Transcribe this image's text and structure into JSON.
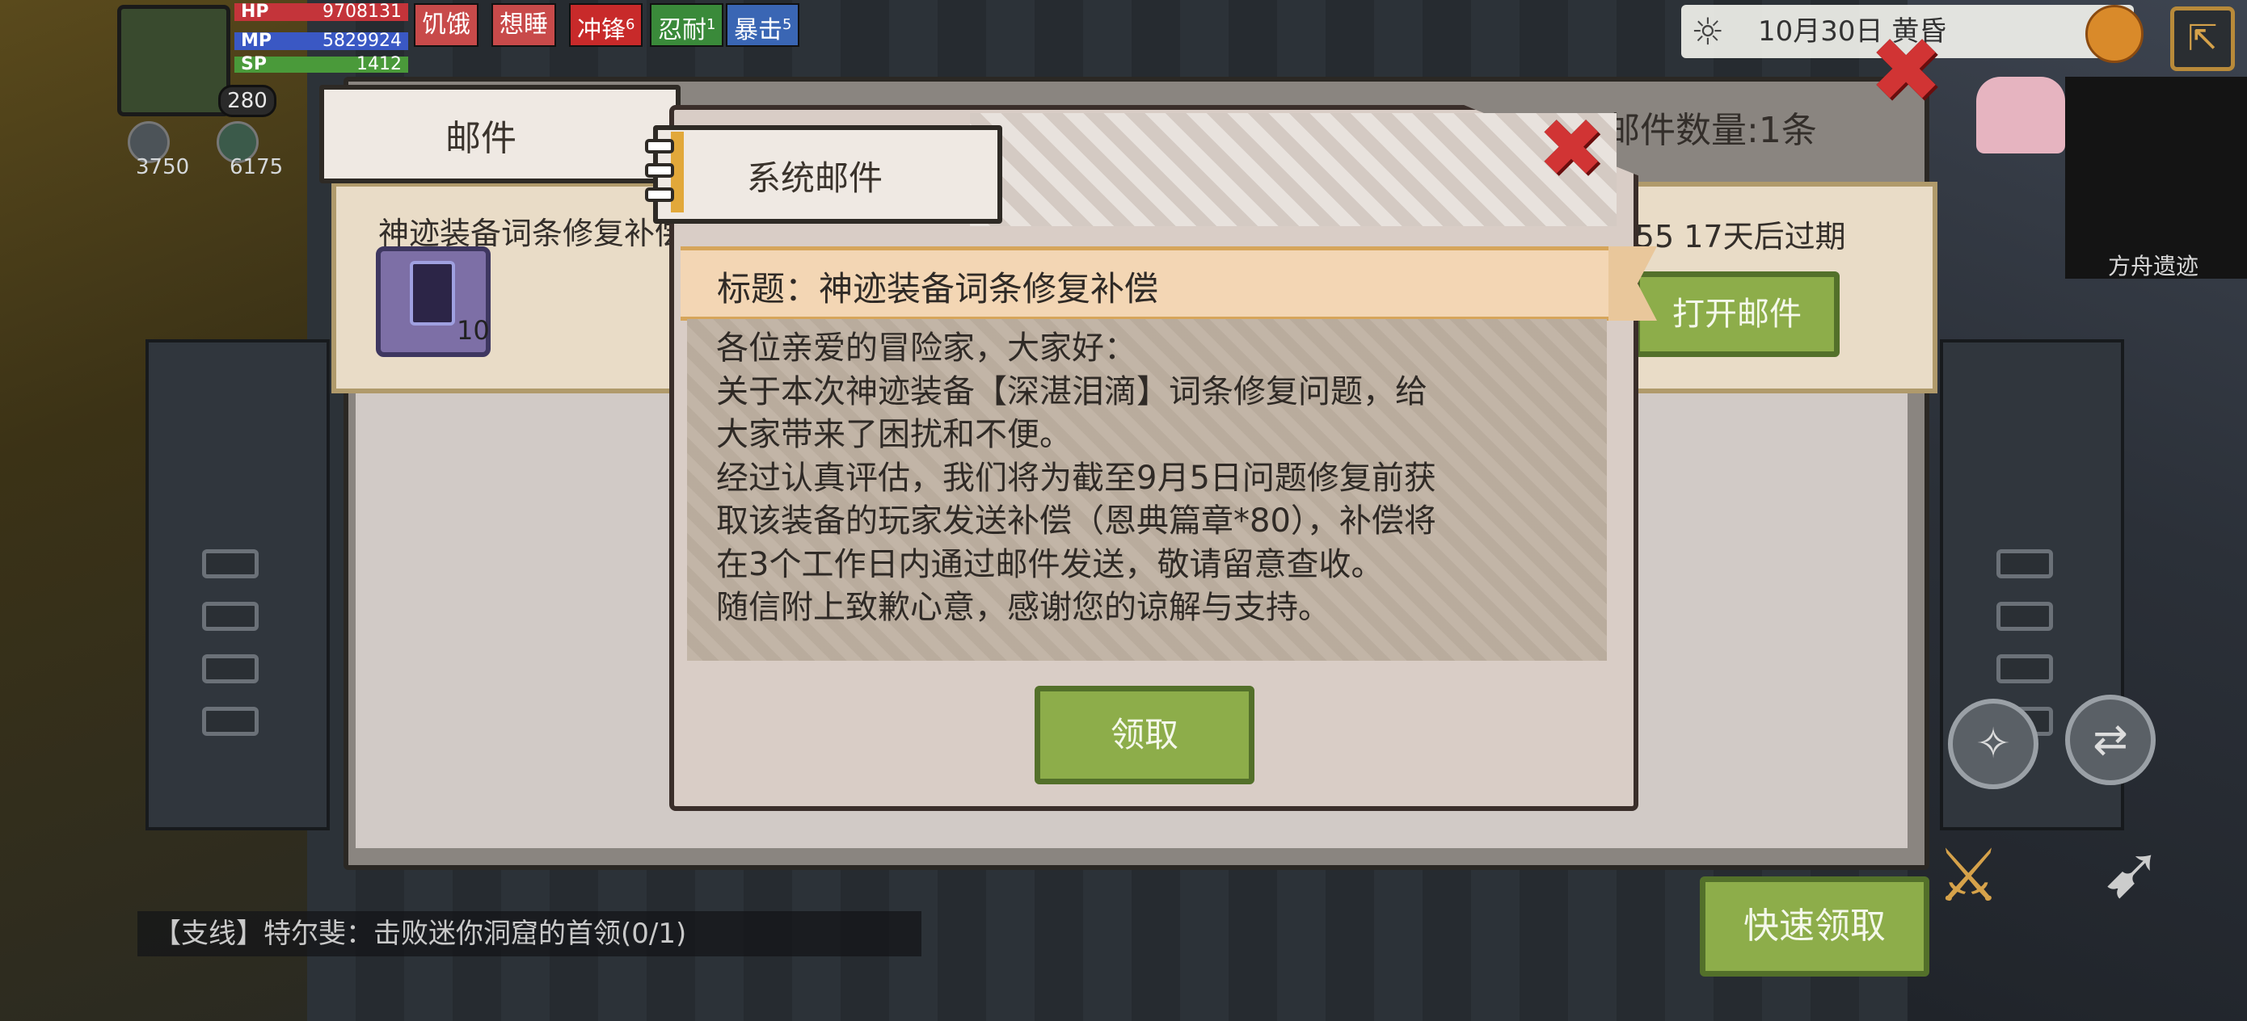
{
  "hud": {
    "level": "280",
    "hp": {
      "label": "HP",
      "value": "9708131",
      "color": "#c4343a"
    },
    "mp": {
      "label": "MP",
      "value": "5829924",
      "color": "#3a58c4"
    },
    "sp": {
      "label": "SP",
      "value": "1412",
      "color": "#4a9a3a"
    },
    "statuses": [
      {
        "label": "饥饿",
        "sup": "",
        "color": "#c84a4a"
      },
      {
        "label": "想睡",
        "sup": "",
        "color": "#c84a4a"
      },
      {
        "label": "冲锋",
        "sup": "6",
        "color": "#c82a2a"
      },
      {
        "label": "忍耐",
        "sup": "1",
        "color": "#3a8a3a"
      },
      {
        "label": "暴击",
        "sup": "5",
        "color": "#3a66b4"
      }
    ],
    "currency_a": "3750",
    "currency_b": "6175",
    "date": "10月30日  黄昏",
    "map_label": "方舟遗迹"
  },
  "mailbox": {
    "tab_label": "邮件",
    "mail_count": "邮件数量:1条",
    "first_mail": {
      "title": "神迹装备词条修复补偿",
      "item_count": "10",
      "expiry": ":55  17天后过期",
      "open_label": "打开邮件"
    },
    "quick_claim_label": "快速领取",
    "quest": "【支线】特尔斐：击败迷你洞窟的首领(0/1)"
  },
  "dialog": {
    "tab_label": "系统邮件",
    "title": "标题：神迹装备词条修复补偿",
    "body": "各位亲爱的冒险家，大家好：\n关于本次神迹装备【深湛泪滴】词条修复问题，给\n大家带来了困扰和不便。\n经过认真评估，我们将为截至9月5日问题修复前获\n取该装备的玩家发送补偿（恩典篇章*80），补偿将\n在3个工作日内通过邮件发送，敬请留意查收。\n随信附上致歉心意，感谢您的谅解与支持。",
    "claim_label": "领取"
  },
  "icons": {
    "close": "close-icon",
    "sun": "sun-icon",
    "globe": "globe-icon",
    "exit": "exit-icon",
    "gem": "gem-icon"
  },
  "colors": {
    "accent_green": "#8dad4a",
    "close_red": "#d13434",
    "banner": "#f3d6b4"
  }
}
